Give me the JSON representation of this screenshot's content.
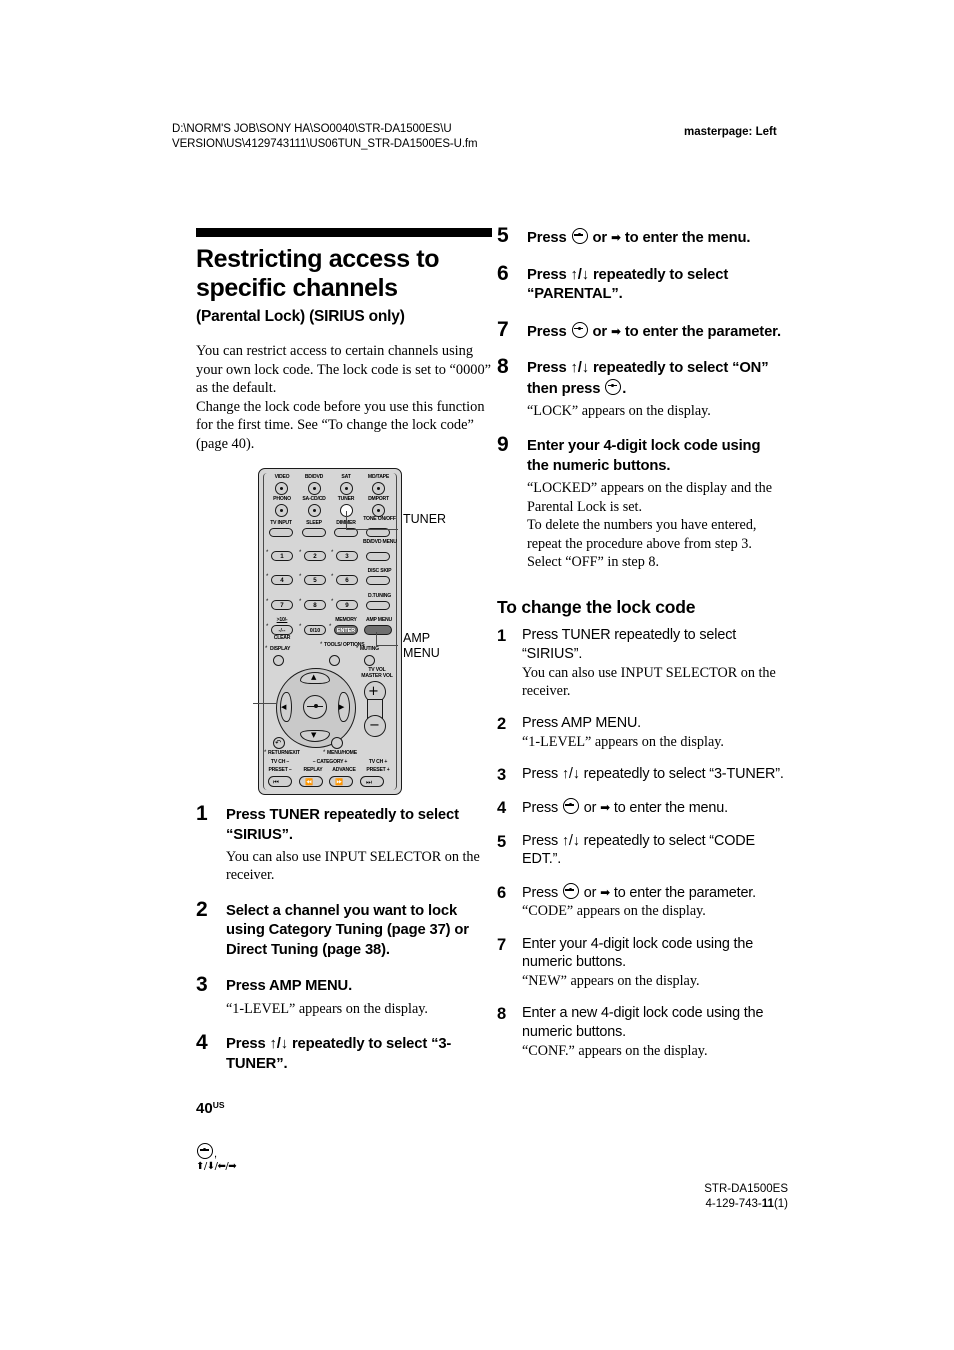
{
  "header": {
    "path_line1": "D:\\NORM'S JOB\\SONY HA\\SO0040\\STR-DA1500ES\\U",
    "path_line2": "VERSION\\US\\4129743111\\US06TUN_STR-DA1500ES-U.fm",
    "masterpage": "masterpage: Left"
  },
  "title": {
    "main": "Restricting access to specific channels",
    "sub": "(Parental Lock) (SIRIUS only)"
  },
  "intro": {
    "p1": "You can restrict access to certain channels using your own lock code. The lock code is set to “0000” as the default.",
    "p2": "Change the lock code before you use this function for the first time. See “To change the lock code” (page 40)."
  },
  "remote": {
    "source_labels": [
      "VIDEO",
      "BD/DVD",
      "SAT",
      "MD/TAPE"
    ],
    "source_labels2": [
      "PHONO",
      "SA-CD/CD",
      "TUNER",
      "DMPORT"
    ],
    "row3": [
      "TV INPUT",
      "SLEEP",
      "DIMMER"
    ],
    "tone": "TONE\nON/OFF",
    "bd_dvd_menu": "BD/DVD\nMENU",
    "disc_skip": "DISC SKIP",
    "d_tuning": "D.TUNING",
    "amp_menu": "AMP MENU",
    "memory": "MEMORY",
    "enter": "ENTER",
    "ten_plus": ">10/-",
    "ten_plus_sym": "-/--",
    "clear": "CLEAR",
    "zero_ten": "0/10",
    "display": "DISPLAY",
    "tools_options": "TOOLS/\nOPTIONS",
    "muting": "MUTING",
    "tv_vol": "TV VOL",
    "master_vol": "MASTER VOL",
    "return_exit": "RETURN/EXIT",
    "menu_home": "MENU/HOME",
    "tv_ch_minus": "TV CH –",
    "preset_minus": "PRESET –",
    "category_minus": "– CATEGORY +",
    "replay": "REPLAY",
    "advance": "ADVANCE",
    "tv_ch_plus": "TV CH +",
    "preset_plus": "PRESET +",
    "numbers": [
      "1",
      "2",
      "3",
      "4",
      "5",
      "6",
      "7",
      "8",
      "9"
    ],
    "callout_tuner": "TUNER",
    "callout_amp_menu": "AMP\nMENU"
  },
  "steps_main": [
    {
      "num": "1",
      "head": "Press TUNER repeatedly to select “SIRIUS”.",
      "body": "You can also use INPUT SELECTOR on the receiver."
    },
    {
      "num": "2",
      "head": "Select a channel you want to lock using Category Tuning (page 37) or Direct Tuning (page 38).",
      "body": ""
    },
    {
      "num": "3",
      "head": "Press AMP MENU.",
      "body": "“1-LEVEL” appears on the display."
    },
    {
      "num": "4",
      "head": "Press ↑/↓ repeatedly to select “3-TUNER”.",
      "body": ""
    }
  ],
  "steps_right": [
    {
      "num": "5",
      "head_pre": "Press ",
      "head_mid": " or ",
      "head_post": " to enter the menu.",
      "body": ""
    },
    {
      "num": "6",
      "head": "Press ↑/↓ repeatedly to select “PARENTAL”.",
      "body": ""
    },
    {
      "num": "7",
      "head_pre": "Press ",
      "head_mid": " or ",
      "head_post": " to enter the parameter.",
      "body": ""
    },
    {
      "num": "8",
      "head_pre": "Press ↑/↓ repeatedly to select “ON” then press ",
      "head_post": ".",
      "body": "“LOCK” appears on the display."
    },
    {
      "num": "9",
      "head": "Enter your 4-digit lock code using the numeric buttons.",
      "body": "“LOCKED” appears on the display and the Parental Lock is set.\nTo delete the numbers you have entered, repeat the procedure above from step 3. Select “OFF” in step 8."
    }
  ],
  "change_code": {
    "heading": "To change the lock code",
    "steps": [
      {
        "num": "1",
        "head": "Press TUNER repeatedly to select “SIRIUS”.",
        "body": "You can also use INPUT SELECTOR on the receiver."
      },
      {
        "num": "2",
        "head": "Press AMP MENU.",
        "body": "“1-LEVEL” appears on the display."
      },
      {
        "num": "3",
        "head": "Press ↑/↓ repeatedly to select “3-TUNER”.",
        "body": ""
      },
      {
        "num": "4",
        "head_pre": "Press ",
        "head_mid": " or ",
        "head_post": " to enter the menu.",
        "body": ""
      },
      {
        "num": "5",
        "head": "Press ↑/↓ repeatedly to select “CODE EDT.”.",
        "body": ""
      },
      {
        "num": "6",
        "head_pre": "Press ",
        "head_mid": " or ",
        "head_post": " to enter the parameter.",
        "body": "“CODE” appears on the display."
      },
      {
        "num": "7",
        "head": "Enter your 4-digit lock code using the numeric buttons.",
        "body": "“NEW” appears on the display."
      },
      {
        "num": "8",
        "head": "Enter a new 4-digit lock code using the numeric buttons.",
        "body": "“CONF.” appears on the display."
      }
    ]
  },
  "footer": {
    "page_number": "40",
    "page_suffix": "US",
    "model": "STR-DA1500ES",
    "part_prefix": "4-129-743-",
    "part_bold": "11",
    "part_suffix": "(1)"
  },
  "colors": {
    "ink": "#000000",
    "remote_body": "#d6d6d6",
    "remote_key": "#d0d0d0",
    "leader": "#4a4a4a"
  }
}
